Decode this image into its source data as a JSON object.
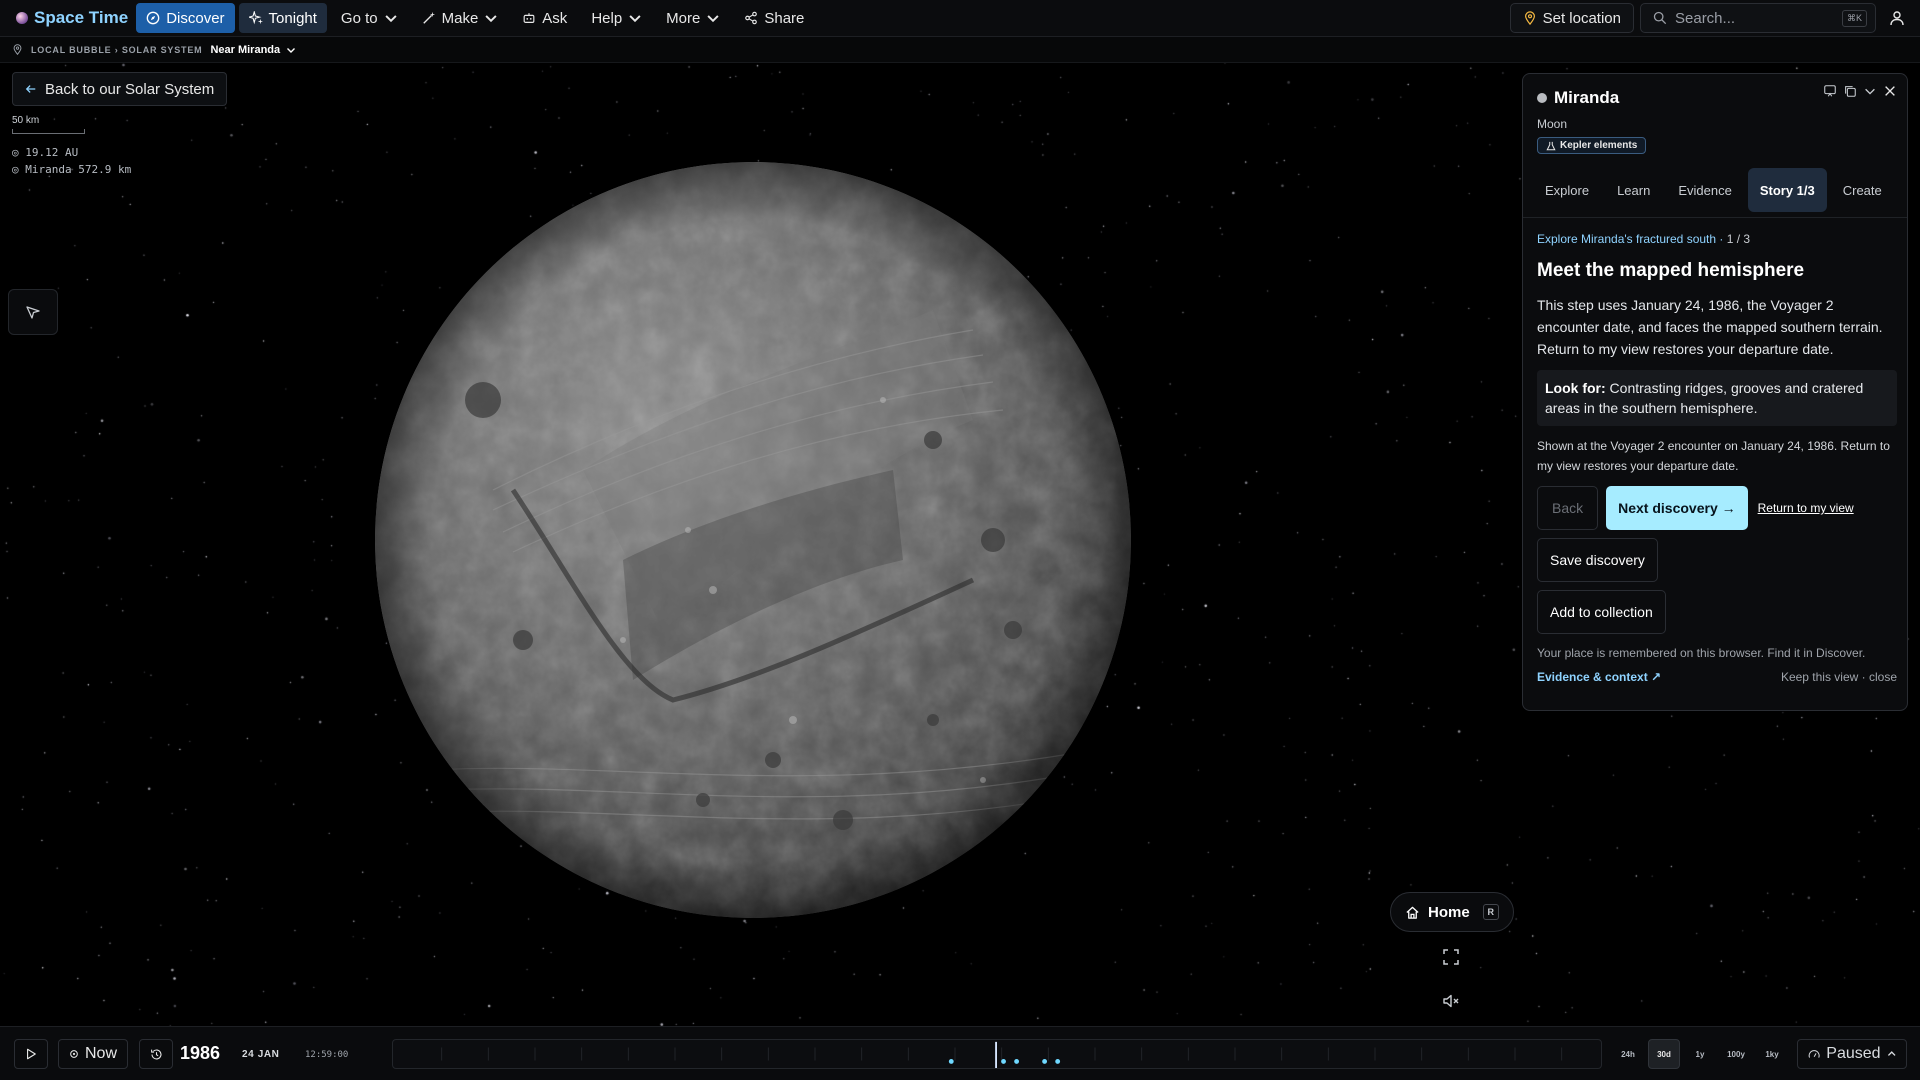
{
  "nav": {
    "brand": "Space Time",
    "items": [
      {
        "id": "discover",
        "label": "Discover",
        "icon": "compass-icon"
      },
      {
        "id": "tonight",
        "label": "Tonight",
        "icon": "sparkle-icon"
      },
      {
        "id": "goto",
        "label": "Go to",
        "icon": ""
      },
      {
        "id": "make",
        "label": "Make",
        "icon": "wand-icon"
      },
      {
        "id": "ask",
        "label": "Ask",
        "icon": "robot-icon"
      },
      {
        "id": "help",
        "label": "Help",
        "icon": ""
      },
      {
        "id": "more",
        "label": "More",
        "icon": ""
      },
      {
        "id": "share",
        "label": "Share",
        "icon": "share-icon"
      }
    ],
    "set_location": "Set location",
    "search_placeholder": "Search...",
    "search_shortcut": "⌘K"
  },
  "breadcrumb": {
    "path": "LOCAL BUBBLE › SOLAR SYSTEM",
    "current": "Near Miranda"
  },
  "viewport": {
    "back_label": "Back to our Solar System",
    "scale_label": "50 km",
    "distance_au": "◎ 19.12 AU",
    "distance_body": "◎ Miranda 572.9 km"
  },
  "panel": {
    "title": "Miranda",
    "subtitle": "Moon",
    "badge": "Kepler elements",
    "tabs": [
      "Explore",
      "Learn",
      "Evidence",
      "Story 1/3",
      "Create"
    ],
    "active_tab": 3,
    "step_label": "Explore Miranda's fractured south ·",
    "step_count": "1 / 3",
    "heading": "Meet the mapped hemisphere",
    "body": "This step uses January 24, 1986, the Voyager 2 encounter date, and faces the mapped southern terrain. Return to my view restores your departure date.",
    "look_for_label": "Look for:",
    "look_for_text": " Contrasting ridges, grooves and cratered areas in the southern hemisphere.",
    "note": "Shown at the Voyager 2 encounter on January 24, 1986. Return to my view restores your departure date.",
    "back_label": "Back",
    "next_label": "Next discovery →",
    "return_label": "Return to my view",
    "save_label": "Save discovery",
    "collection_label": "Add to collection",
    "remember_text": "Your place is remembered on this browser. Find it in Discover.",
    "evidence_label": "Evidence & context ↗",
    "keep_label": "Keep this view · close"
  },
  "controls": {
    "home_label": "Home",
    "home_key": "R"
  },
  "timeline": {
    "now_label": "Now",
    "year": "1986",
    "date": "24 JAN",
    "time": "12:59:00",
    "scales": [
      "24h",
      "30d",
      "1y",
      "100y",
      "1ky"
    ],
    "active_scale": 1,
    "status": "Paused"
  },
  "colors": {
    "accent_blue": "#1d5fa8",
    "accent_cyan": "#a6ecff",
    "link_cyan": "#8fd3ff"
  }
}
